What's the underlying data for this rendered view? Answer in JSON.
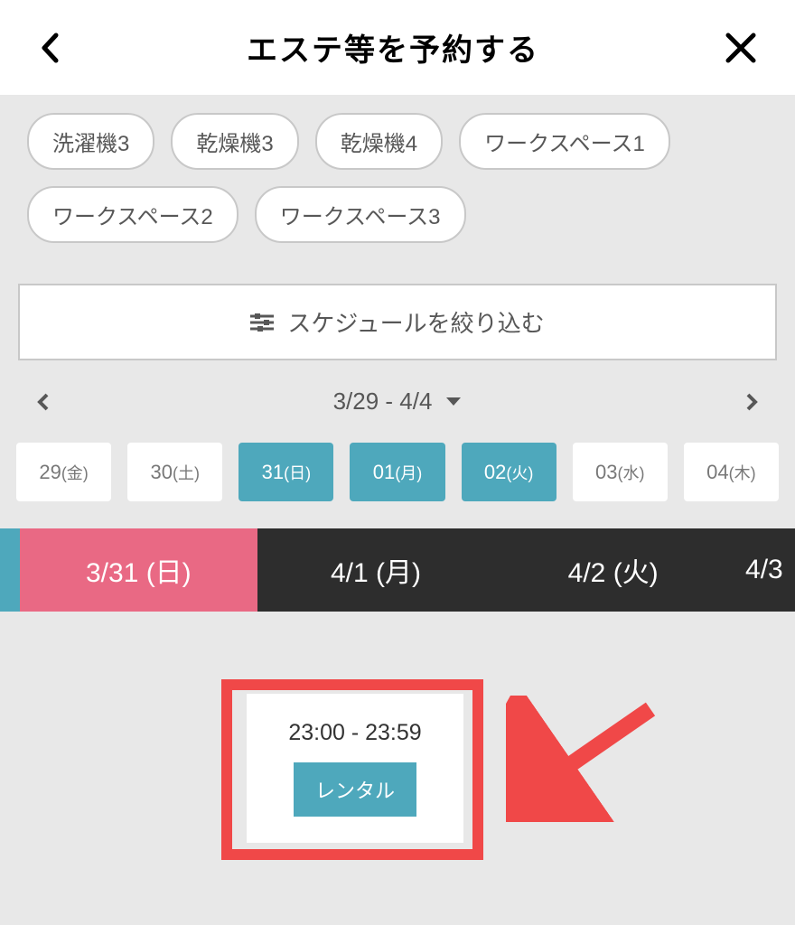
{
  "header": {
    "title": "エステ等を予約する"
  },
  "filters": {
    "items": [
      "洗濯機3",
      "乾燥機3",
      "乾燥機4",
      "ワークスペース1",
      "ワークスペース2",
      "ワークスペース3"
    ]
  },
  "scheduleFilter": {
    "label": "スケジュールを絞り込む"
  },
  "weekNav": {
    "range": "3/29 - 4/4"
  },
  "dayTabs": {
    "items": [
      {
        "day": "29",
        "wd": "(金)",
        "selected": false
      },
      {
        "day": "30",
        "wd": "(土)",
        "selected": false
      },
      {
        "day": "31",
        "wd": "(日)",
        "selected": true
      },
      {
        "day": "01",
        "wd": "(月)",
        "selected": true
      },
      {
        "day": "02",
        "wd": "(火)",
        "selected": true
      },
      {
        "day": "03",
        "wd": "(水)",
        "selected": false
      },
      {
        "day": "04",
        "wd": "(木)",
        "selected": false
      }
    ]
  },
  "dateStrip": {
    "items": [
      {
        "label": "3/31 (日)",
        "style": "pink"
      },
      {
        "label": "4/1 (月)",
        "style": "dark"
      },
      {
        "label": "4/2 (火)",
        "style": "dark"
      },
      {
        "label": "4/3",
        "style": "dark last"
      }
    ]
  },
  "card": {
    "time": "23:00 - 23:59",
    "button": "レンタル"
  }
}
